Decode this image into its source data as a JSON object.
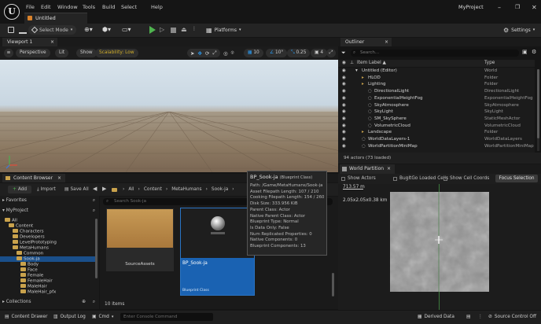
{
  "app": {
    "tab_title": "Untitled",
    "project_name": "MyProject",
    "logo_text": "U",
    "menus": [
      "File",
      "Edit",
      "Window",
      "Tools",
      "Build",
      "Select",
      "Help"
    ]
  },
  "toolbar": {
    "select_mode": "Select Mode",
    "platforms": "Platforms",
    "settings": "Settings"
  },
  "viewport": {
    "tab_label": "Viewport 1",
    "perspective": "Perspective",
    "lit": "Lit",
    "show": "Show",
    "scalability": "Scalability: Low",
    "grid_value": "10",
    "angle_value": "10°",
    "scale_value": "0.25",
    "camera_speed": "4"
  },
  "outliner": {
    "tab_label": "Outliner",
    "search_placeholder": "Search...",
    "col_label": "Item Label ▲",
    "col_type": "Type",
    "rows": [
      {
        "label": "Untitled (Editor)",
        "type": "World",
        "indent": 0
      },
      {
        "label": "HLOD",
        "type": "Folder",
        "indent": 1
      },
      {
        "label": "Lighting",
        "type": "Folder",
        "indent": 1
      },
      {
        "label": "DirectionalLight",
        "type": "DirectionalLight",
        "indent": 2
      },
      {
        "label": "ExponentialHeightFog",
        "type": "ExponentialHeightFog",
        "indent": 2
      },
      {
        "label": "SkyAtmosphere",
        "type": "SkyAtmosphere",
        "indent": 2
      },
      {
        "label": "SkyLight",
        "type": "SkyLight",
        "indent": 2
      },
      {
        "label": "SM_SkySphere",
        "type": "StaticMeshActor",
        "indent": 2
      },
      {
        "label": "VolumetricCloud",
        "type": "VolumetricCloud",
        "indent": 2
      },
      {
        "label": "Landscape",
        "type": "Folder",
        "indent": 1
      },
      {
        "label": "WorldDataLayers-1",
        "type": "WorldDataLayers",
        "indent": 1
      },
      {
        "label": "WorldPartitionMiniMap",
        "type": "WorldPartitionMiniMap",
        "indent": 1
      }
    ],
    "footer": "94 actors (73 loaded)"
  },
  "world_partition": {
    "tab_label": "World Partition",
    "show_actors": "Show Actors",
    "bugitgo": "BugItGo Loaded Cells",
    "show_cell_coords": "Show Cell Coords",
    "focus_selection": "Focus Selection",
    "distance": "713.57 m",
    "cell_size": "2.05x2.05x0.38 km"
  },
  "content_browser": {
    "tab_label": "Content Browser",
    "add": "Add",
    "import": "Import",
    "save_all": "Save All",
    "breadcrumb": [
      "All",
      "Content",
      "MetaHumans",
      "Sook-ja"
    ],
    "favorites": "Favorites",
    "project": "MyProject",
    "tree": [
      {
        "label": "All",
        "indent": 0
      },
      {
        "label": "Content",
        "indent": 1
      },
      {
        "label": "Characters",
        "indent": 2
      },
      {
        "label": "Developers",
        "indent": 2
      },
      {
        "label": "LevelPrototyping",
        "indent": 2
      },
      {
        "label": "MetaHumans",
        "indent": 2
      },
      {
        "label": "Common",
        "indent": 3
      },
      {
        "label": "Sook-ja",
        "indent": 3
      },
      {
        "label": "Body",
        "indent": 4
      },
      {
        "label": "Face",
        "indent": 4
      },
      {
        "label": "Female",
        "indent": 4
      },
      {
        "label": "FemaleHair",
        "indent": 4
      },
      {
        "label": "MaleHair",
        "indent": 4
      },
      {
        "label": "MaleHair_pfx",
        "indent": 4
      }
    ],
    "collections": "Collections",
    "search_placeholder": "Search Sook-ja",
    "assets": [
      {
        "name": "SourceAssets",
        "kind": "Folder"
      },
      {
        "name": "BP_Sook-ja",
        "kind": "Blueprint Class"
      }
    ],
    "item_count": "10 items"
  },
  "tooltip": {
    "title": "BP_Sook-ja",
    "subtitle": "(Blueprint Class)",
    "lines": [
      "Path: /Game/MetaHumans/Sook-ja",
      "Asset Filepath Length: 107 / 210",
      "Cooking Filepath Length: 154 / 260",
      "Disk Size: 333.956 KiB",
      "Parent Class: Actor",
      "Native Parent Class: Actor",
      "Blueprint Type: Normal",
      "Is Data Only: False",
      "Num Replicated Properties: 0",
      "Native Components: 0",
      "Blueprint Components: 13"
    ]
  },
  "status_bar": {
    "content_drawer": "Content Drawer",
    "output_log": "Output Log",
    "cmd": "Cmd",
    "console_placeholder": "Enter Console Command",
    "derived_data": "Derived Data",
    "source_control": "Source Control Off"
  },
  "colors": {
    "accent": "#2a74c4",
    "selection": "#1a62b2",
    "folder": "#c9a24c",
    "play": "#4fb34f",
    "scalability": "#d4b12c"
  }
}
